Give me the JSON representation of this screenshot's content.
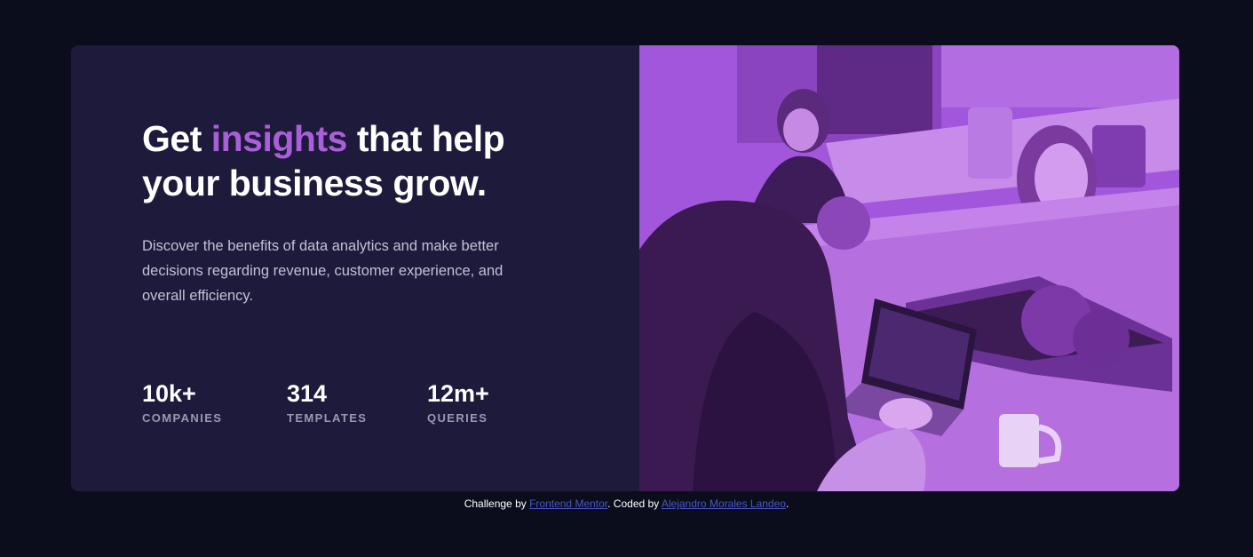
{
  "card": {
    "headline": {
      "part1": "Get ",
      "accent": "insights",
      "part2": " that help your business grow."
    },
    "description": "Discover the benefits of data analytics and make better decisions regarding revenue, customer experience, and overall efficiency.",
    "stats": [
      {
        "value": "10k+",
        "label": "COMPANIES"
      },
      {
        "value": "314",
        "label": "TEMPLATES"
      },
      {
        "value": "12m+",
        "label": "QUERIES"
      }
    ]
  },
  "attribution": {
    "prefix": "Challenge by ",
    "link1": "Frontend Mentor",
    "middle": ". Coded by ",
    "link2": "Alejandro Morales Landeo",
    "suffix": "."
  },
  "colors": {
    "page_background": "#0b0d1c",
    "card_background": "#1d1a3b",
    "accent": "#a95fd8",
    "image_overlay": "#a256db",
    "link": "#4b57c9"
  }
}
